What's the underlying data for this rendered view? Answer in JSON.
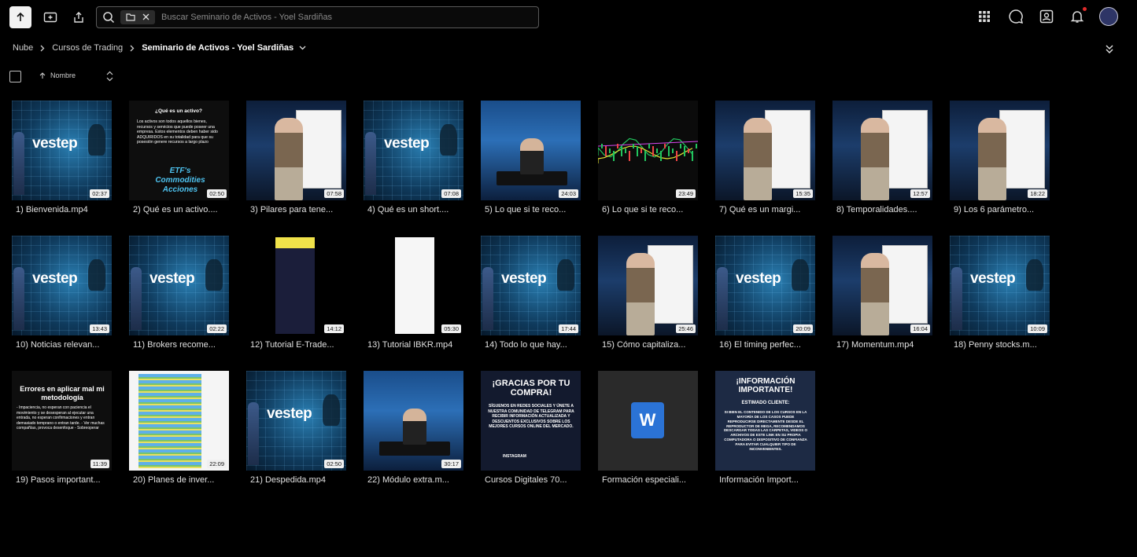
{
  "search": {
    "placeholder": "Buscar Seminario de Activos - Yoel Sardiñas"
  },
  "breadcrumb": {
    "items": [
      "Nube",
      "Cursos de Trading"
    ],
    "current": "Seminario de Activos - Yoel Sardiñas"
  },
  "sort": {
    "label": "Nombre"
  },
  "files": [
    {
      "name": "1) Bienvenida.mp4",
      "duration": "02:37",
      "thumb": "logo"
    },
    {
      "name": "2) Qué es un activo....",
      "duration": "02:50",
      "thumb": "activo"
    },
    {
      "name": "3) Pilares para tene...",
      "duration": "07:58",
      "thumb": "stage"
    },
    {
      "name": "4) Qué es un short....",
      "duration": "07:08",
      "thumb": "logo"
    },
    {
      "name": "5) Lo que si te reco...",
      "duration": "24:03",
      "thumb": "desk"
    },
    {
      "name": "6) Lo que si te reco...",
      "duration": "23:49",
      "thumb": "chart"
    },
    {
      "name": "7) Qué es un margi...",
      "duration": "15:35",
      "thumb": "stage"
    },
    {
      "name": "8) Temporalidades....",
      "duration": "12:57",
      "thumb": "stage"
    },
    {
      "name": "9) Los 6 parámetro...",
      "duration": "18:22",
      "thumb": "stage"
    },
    {
      "name": "10) Noticias relevan...",
      "duration": "13:43",
      "thumb": "logo"
    },
    {
      "name": "11) Brokers recome...",
      "duration": "02:22",
      "thumb": "logo"
    },
    {
      "name": "12) Tutorial E-Trade...",
      "duration": "14:12",
      "thumb": "phone"
    },
    {
      "name": "13) Tutorial IBKR.mp4",
      "duration": "05:30",
      "thumb": "phone2"
    },
    {
      "name": "14) Todo lo que hay...",
      "duration": "17:44",
      "thumb": "logo"
    },
    {
      "name": "15) Cómo capitaliza...",
      "duration": "25:46",
      "thumb": "stage"
    },
    {
      "name": "16) El timing perfec...",
      "duration": "20:09",
      "thumb": "logo"
    },
    {
      "name": "17) Momentum.mp4",
      "duration": "16:04",
      "thumb": "stage"
    },
    {
      "name": "18) Penny stocks.m...",
      "duration": "10:09",
      "thumb": "logo"
    },
    {
      "name": "19) Pasos important...",
      "duration": "11:39",
      "thumb": "errores"
    },
    {
      "name": "20) Planes de inver...",
      "duration": "22:09",
      "thumb": "sheet"
    },
    {
      "name": "21) Despedida.mp4",
      "duration": "02:50",
      "thumb": "logo"
    },
    {
      "name": "22) Módulo extra.m...",
      "duration": "30:17",
      "thumb": "desk"
    },
    {
      "name": "Cursos Digitales 70...",
      "duration": "",
      "thumb": "gracias"
    },
    {
      "name": "Formación especiali...",
      "duration": "",
      "thumb": "word"
    },
    {
      "name": "Información Import...",
      "duration": "",
      "thumb": "info"
    }
  ],
  "thumb_text": {
    "logo_word": "vestep",
    "activo_title": "¿Qué es un activo?",
    "activo_body": "Los activos son todos aquellos bienes, recursos y servicios que puede poseer una empresa. Estos elementos deben haber sido ADQUIRIDOS en su totalidad para que su posesión genere recursos a largo plazo",
    "activo_big": "ETF's Commodities Acciones",
    "errores_title": "Errores en aplicar mal mi metodología",
    "errores_body": "- Impaciencia, no esperan con paciencia el movimiento y se desesperan al ejecutar una entrada, no esperan confirmaciones y entran demasiado temprano o entran tarde. - Ver muchas compañías, provoca desenfoque - Sobreoperar",
    "gracias_title": "¡GRACIAS POR TU COMPRA!",
    "gracias_body": "SÍGUENOS EN REDES SOCIALES Y ÚNETE A NUESTRA COMUNIDAD DE TELEGRAM PARA RECIBIR INFORMACIÓN ACTUALIZADA Y DESCUENTOS EXCLUSIVOS SOBRE LOS MEJORES CURSOS ONLINE DEL MERCADO.",
    "gracias_ig": "INSTAGRAM",
    "info_title": "¡INFORMACIÓN IMPORTANTE!",
    "info_sub": "ESTIMADO CLIENTE:",
    "info_body": "SI BIEN EL CONTENIDO DE LOS CURSOS EN LA MAYORÍA DE LOS CASOS PUEDE REPRODUCIRSE DIRECTAMENTE DESDE EL REPRODUCTOR DE MEGA, RECOMENDAMOS DESCARGAR TODAS LAS CARPETAS, VIDEOS O ARCHIVOS DE ESTE LINK EN SU PROPIA COMPUTADORA O DISPOSITIVO DE CONFIANZA PARA EVITAR CUALQUIER TIPO DE INCONVENIENTES.",
    "word_letter": "W"
  }
}
